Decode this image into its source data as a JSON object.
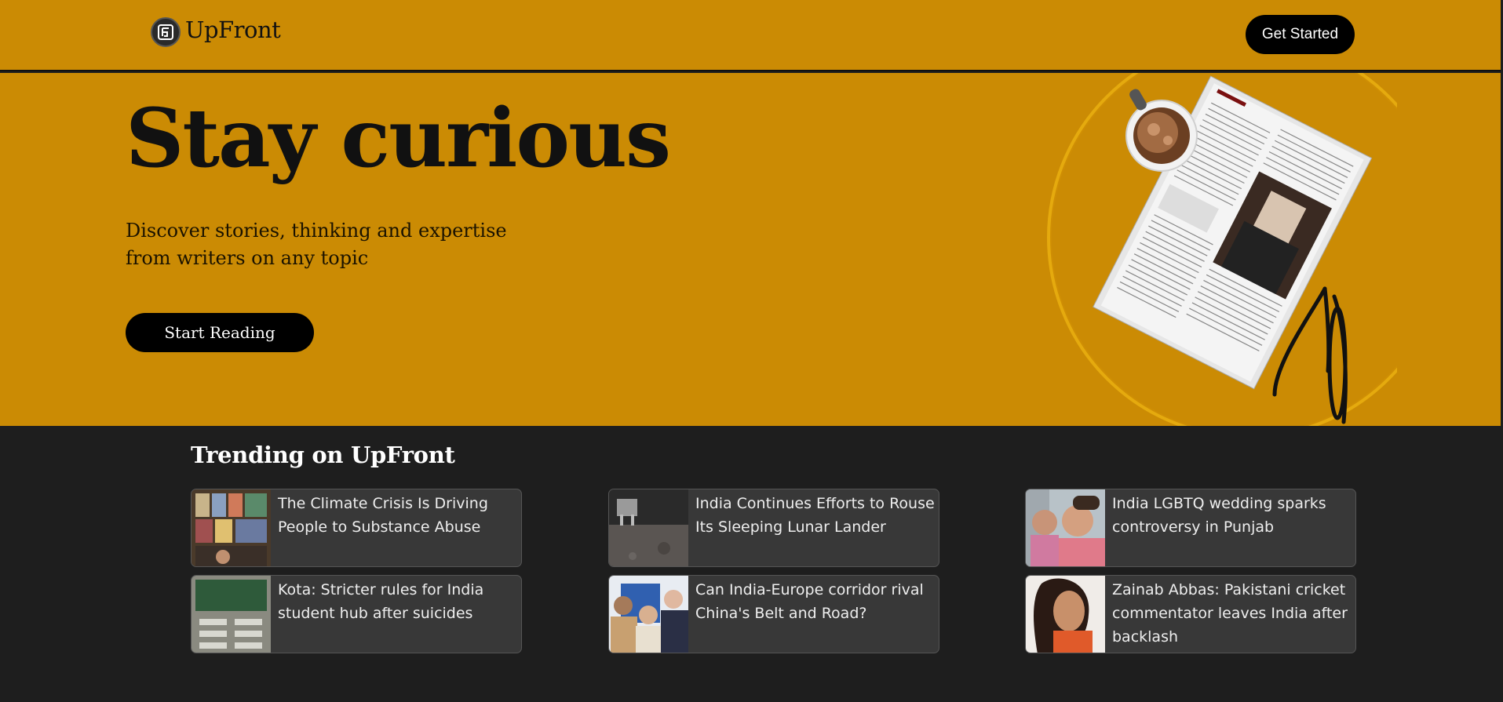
{
  "header": {
    "brand_name": "UpFront",
    "logo_icon": "upfront-logo-icon",
    "cta_label": "Get Started"
  },
  "hero": {
    "title": "Stay curious",
    "subtitle": "Discover stories, thinking and expertise from writers on any topic",
    "button_label": "Start Reading",
    "illustration": "newspaper-coffee-glasses-illustration"
  },
  "trending": {
    "title": "Trending on UpFront",
    "articles": [
      {
        "headline": "The Climate Crisis Is Driving People to Substance Abuse",
        "thumbnail": "market-stall-photo"
      },
      {
        "headline": "India Continues Efforts to Rouse Its Sleeping Lunar Lander",
        "thumbnail": "lunar-surface-photo"
      },
      {
        "headline": "India LGBTQ wedding sparks controversy in Punjab",
        "thumbnail": "couple-photo"
      },
      {
        "headline": "Kota: Stricter rules for India student hub after suicides",
        "thumbnail": "classroom-photo"
      },
      {
        "headline": "Can India-Europe corridor rival China's Belt and Road?",
        "thumbnail": "leaders-handshake-photo"
      },
      {
        "headline": "Zainab Abbas: Pakistani cricket commentator leaves India after backlash",
        "thumbnail": "portrait-photo"
      }
    ]
  },
  "colors": {
    "accent": "#cb8b04",
    "dark_background": "#1e1e1e",
    "card_background": "#383838",
    "button": "#000000"
  }
}
